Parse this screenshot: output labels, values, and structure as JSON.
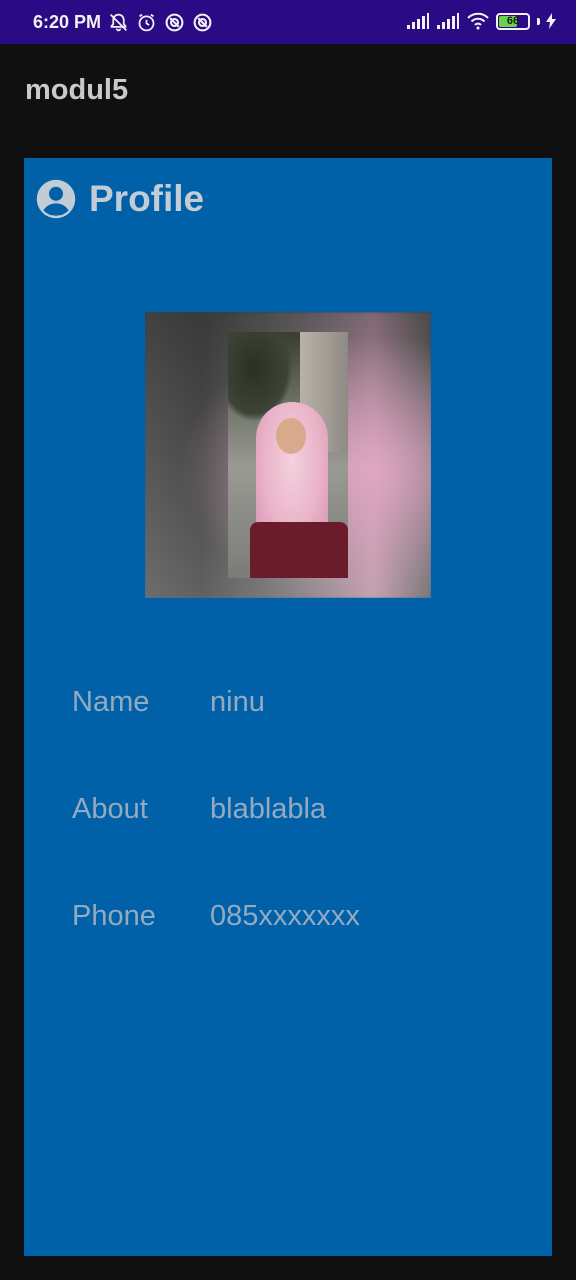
{
  "status_bar": {
    "time": "6:20 PM",
    "battery_level": "66",
    "battery_fill_percent": 66,
    "colors": {
      "background": "#2a0a85",
      "battery": "#6cd14a"
    },
    "icons": [
      "notifications-off-icon",
      "alarm-icon",
      "app-status-icon",
      "app-status-icon",
      "cellular-signal-icon",
      "cellular-signal-icon",
      "wifi-icon",
      "battery-icon",
      "charging-icon"
    ]
  },
  "app_bar": {
    "title": "modul5"
  },
  "card": {
    "title": "Profile",
    "icon": "account-circle-icon",
    "background_color": "#0060a8",
    "fields": [
      {
        "label": "Name",
        "value": "ninu"
      },
      {
        "label": "About",
        "value": "blablabla"
      },
      {
        "label": "Phone",
        "value": "085xxxxxxx"
      }
    ]
  }
}
